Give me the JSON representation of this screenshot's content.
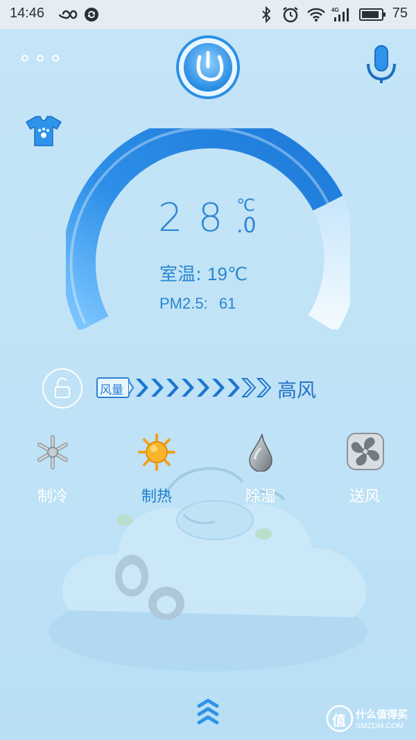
{
  "status_bar": {
    "time": "14:46",
    "battery_percent": "75",
    "icons": [
      "infinity-icon",
      "sync-icon",
      "bluetooth-icon",
      "alarm-icon",
      "wifi-icon",
      "4g-signal-icon",
      "battery-icon"
    ]
  },
  "header": {
    "menu_icon": "more-dots-icon",
    "power_icon": "power-icon",
    "voice_icon": "microphone-icon",
    "clothes_icon": "tshirt-icon"
  },
  "dial": {
    "set_temp": "28",
    "unit": "℃",
    "decimal": ".0",
    "room_temp_label": "室温:",
    "room_temp_value": "19℃",
    "pm_label": "PM2.5:",
    "pm_value": "61",
    "colors": {
      "arc": "#2f8fe8",
      "arc_light": "#e8f5ff",
      "text": "#2f86d6"
    }
  },
  "fan": {
    "badge_label": "风量",
    "level_text": "高风",
    "filled_chevrons": 7,
    "total_chevrons": 9,
    "lock_icon": "lock-icon"
  },
  "modes": [
    {
      "label": "制冷",
      "icon": "snowflake-icon",
      "active": false
    },
    {
      "label": "制热",
      "icon": "sun-icon",
      "active": true
    },
    {
      "label": "除湿",
      "icon": "droplet-icon",
      "active": false
    },
    {
      "label": "送风",
      "icon": "fan-icon",
      "active": false
    }
  ],
  "footer": {
    "expand_icon": "chevrons-up-icon",
    "watermark_title": "什么值得买",
    "watermark_site": "SMZDM.COM",
    "watermark_logo_char": "值"
  }
}
